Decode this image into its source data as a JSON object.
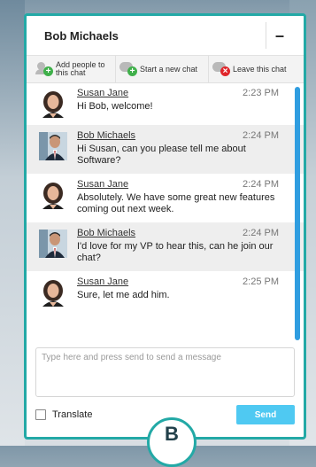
{
  "window": {
    "title": "Bob Michaels",
    "minimize_label": "–"
  },
  "toolbar": {
    "add_people": "Add people to this chat",
    "add_people_line1": "Add people to",
    "add_people_line2": "this chat",
    "new_chat": "Start a new chat",
    "leave_chat": "Leave this chat",
    "icons": [
      "add-person-icon",
      "new-chat-icon",
      "leave-chat-icon"
    ]
  },
  "messages": [
    {
      "sender": "Susan Jane",
      "time": "2:23 PM",
      "text": "Hi Bob, welcome!",
      "avatar": "female",
      "shaded": false
    },
    {
      "sender": "Bob Michaels",
      "time": "2:24 PM",
      "text": "Hi Susan, can you please tell me about Software?",
      "avatar": "male",
      "shaded": true
    },
    {
      "sender": "Susan Jane",
      "time": "2:24 PM",
      "text": "Absolutely.  We have some great new features coming out next week.",
      "avatar": "female",
      "shaded": false
    },
    {
      "sender": "Bob Michaels",
      "time": "2:24 PM",
      "text": "I'd love for my VP to hear this, can he join our chat?",
      "avatar": "male",
      "shaded": true
    },
    {
      "sender": "Susan Jane",
      "time": "2:25 PM",
      "text": "Sure, let me add him.",
      "avatar": "female",
      "shaded": false
    }
  ],
  "input": {
    "placeholder": "Type here and press send to send a message"
  },
  "footer": {
    "translate_label": "Translate",
    "translate_checked": false,
    "send_label": "Send"
  },
  "bottom_badge": {
    "letter": "B"
  },
  "colors": {
    "border": "#23a9a6",
    "send": "#4fc9f2",
    "scrollbar": "#2f9de0",
    "green": "#3fb04a",
    "red": "#e0262b"
  }
}
